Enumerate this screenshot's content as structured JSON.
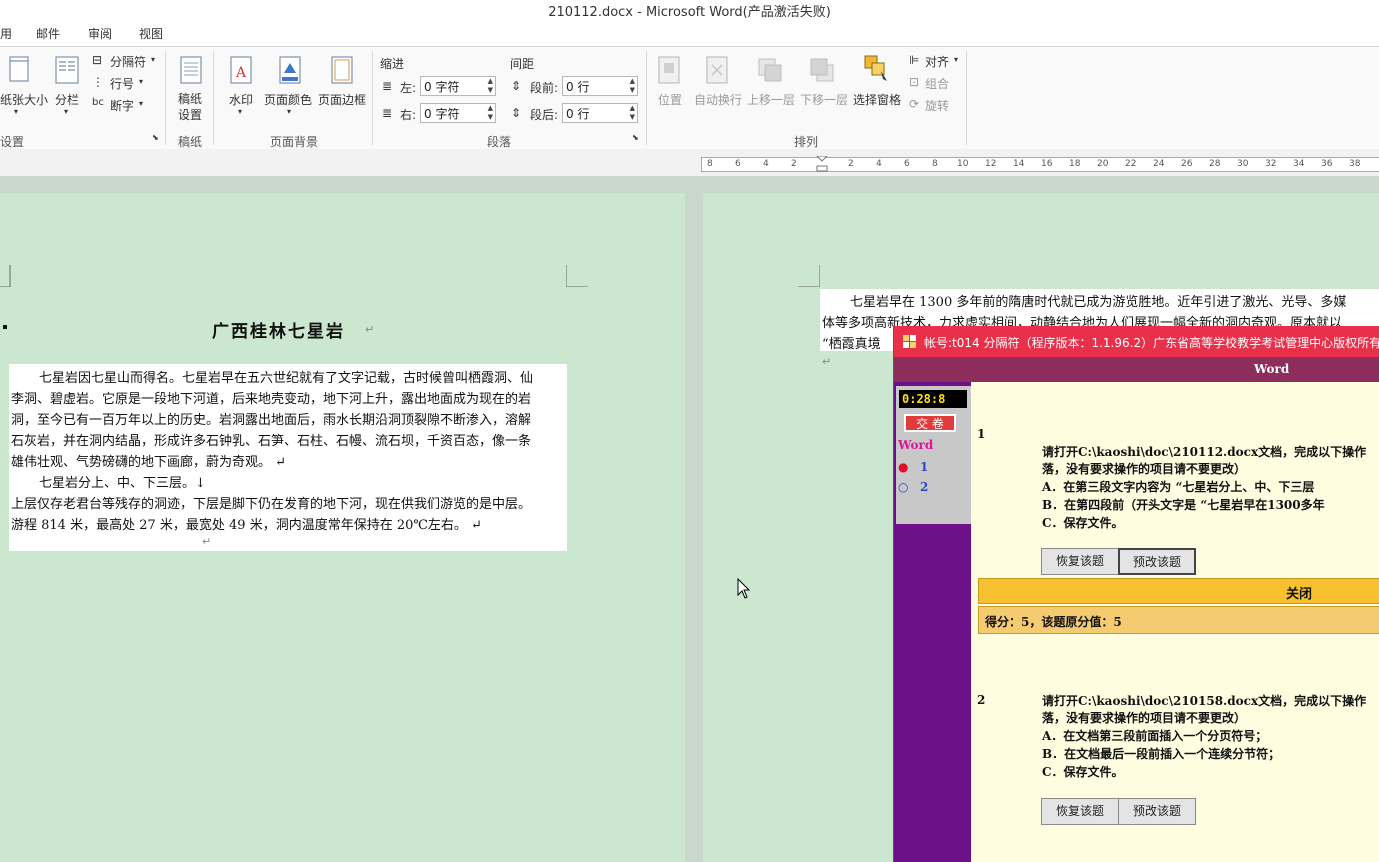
{
  "window": {
    "title": "210112.docx - Microsoft Word(产品激活失败)"
  },
  "menu": [
    "用",
    "邮件",
    "审阅",
    "视图"
  ],
  "ribbon": {
    "page_setup": {
      "paper_size": "纸张大小",
      "columns": "分栏",
      "breaks": "分隔符",
      "line_numbers": "行号",
      "hyphenation": "断字",
      "group_label": "设置"
    },
    "draft": {
      "label": "稿纸设置",
      "label_top": "稿纸",
      "label_bottom": "设置",
      "group_label": "稿纸"
    },
    "page_background": {
      "watermark": "水印",
      "page_color": "页面颜色",
      "page_borders": "页面边框",
      "group_label": "页面背景"
    },
    "paragraph": {
      "indent_title": "缩进",
      "spacing_title": "间距",
      "left_label": "左:",
      "left_value": "0 字符",
      "right_label": "右:",
      "right_value": "0 字符",
      "before_label": "段前:",
      "before_value": "0 行",
      "after_label": "段后:",
      "after_value": "0 行",
      "group_label": "段落"
    },
    "arrange": {
      "position": "位置",
      "wrap_text": "自动换行",
      "bring_forward": "上移一层",
      "send_backward": "下移一层",
      "selection_pane": "选择窗格",
      "align": "对齐",
      "group": "组合",
      "rotate": "旋转",
      "group_label": "排列"
    }
  },
  "ruler": {
    "ticks": [
      "8",
      "6",
      "4",
      "2",
      "",
      "2",
      "4",
      "6",
      "8",
      "10",
      "12",
      "14",
      "16",
      "18",
      "20",
      "22",
      "24",
      "26",
      "28",
      "30",
      "32",
      "34",
      "36",
      "38"
    ]
  },
  "document": {
    "heading": "广西桂林七星岩",
    "left_paragraphs": [
      "七星岩因七星山而得名。七星岩早在五六世纪就有了文字记载，古时候曾叫栖霞洞、仙",
      "李洞、碧虚岩。它原是一段地下河道，后来地壳变动，地下河上升，露出地面成为现在的岩",
      "洞，至今已有一百万年以上的历史。岩洞露出地面后，雨水长期沿洞顶裂隙不断渗入，溶解",
      "石灰岩，并在洞内结晶，形成许多石钟乳、石笋、石柱、石幔、流石坝，千资百态，像一条",
      "雄伟壮观、气势磅礴的地下画廊，蔚为奇观。 ↵",
      "七星岩分上、中、下三层。↓",
      "上层仅存老君台等残存的洞迹，下层是脚下仍在发育的地下河，现在供我们游览的是中层。",
      "游程 814 米，最高处 27 米，最宽处 49 米，洞内温度常年保持在 20℃左右。 ↵"
    ],
    "right_paragraphs": [
      "七星岩早在 1300 多年前的隋唐时代就已成为游览胜地。近年引进了激光、光导、多媒",
      "体等多项高新技术，力求虚实相间，动静结合地为人们展现一幅全新的洞内奇观。原本就以",
      "“栖霞真境"
    ]
  },
  "exam": {
    "title": "帐号:t014  分隔符（程序版本：1.1.96.2）广东省高等学校教学考试管理中心版权所有",
    "subject": "Word",
    "timer": "0:28:8",
    "submit_label": "交 卷",
    "sidebar_subject": "Word",
    "nav": [
      {
        "marker": "●",
        "label": "1"
      },
      {
        "marker": "○",
        "label": "2"
      }
    ],
    "questions": [
      {
        "number": "1",
        "lines": [
          "请打开C:\\kaoshi\\doc\\210112.docx文档，完成以下操作",
          "落，没有要求操作的项目请不要更改）",
          "A．在第三段文字内容为 “七星岩分上、中、下三层",
          "B．在第四段前（开头文字是 “七星岩早在1300多年",
          "C．保存文件。"
        ],
        "restore": "恢复该题",
        "grade": "预改该题"
      },
      {
        "number": "2",
        "lines": [
          "请打开C:\\kaoshi\\doc\\210158.docx文档，完成以下操作",
          "落，没有要求操作的项目请不要更改）",
          "A．在文档第三段前面插入一个分页符号；",
          "B．在文档最后一段前插入一个连续分节符；",
          "C．保存文件。"
        ],
        "restore": "恢复该题",
        "grade": "预改该题"
      }
    ],
    "close_label": "关闭",
    "score_text": "得分：5，该题原分值：5"
  }
}
